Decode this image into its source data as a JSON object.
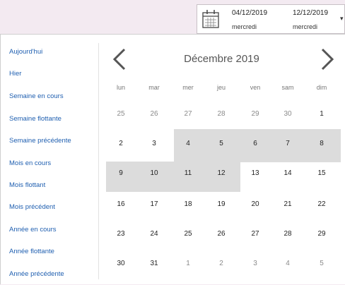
{
  "range": {
    "start_date": "04/12/2019",
    "start_day": "mercredi",
    "end_date": "12/12/2019",
    "end_day": "mercredi"
  },
  "presets": [
    "Aujourd'hui",
    "Hier",
    "Semaine en cours",
    "Semaine flottante",
    "Semaine précédente",
    "Mois en cours",
    "Mois flottant",
    "Mois précédent",
    "Année en cours",
    "Année flottante",
    "Année précédente"
  ],
  "calendar": {
    "month_title": "Décembre 2019",
    "weekdays": [
      "lun",
      "mar",
      "mer",
      "jeu",
      "ven",
      "sam",
      "dim"
    ],
    "weeks": [
      [
        "25",
        "26",
        "27",
        "28",
        "29",
        "30",
        "1"
      ],
      [
        "2",
        "3",
        "4",
        "5",
        "6",
        "7",
        "8"
      ],
      [
        "9",
        "10",
        "11",
        "12",
        "13",
        "14",
        "15"
      ],
      [
        "16",
        "17",
        "18",
        "19",
        "20",
        "21",
        "22"
      ],
      [
        "23",
        "24",
        "25",
        "26",
        "27",
        "28",
        "29"
      ],
      [
        "30",
        "31",
        "1",
        "2",
        "3",
        "4",
        "5"
      ]
    ]
  },
  "colors": {
    "selection": "#dcdcdc",
    "link": "#1f5fb0"
  }
}
